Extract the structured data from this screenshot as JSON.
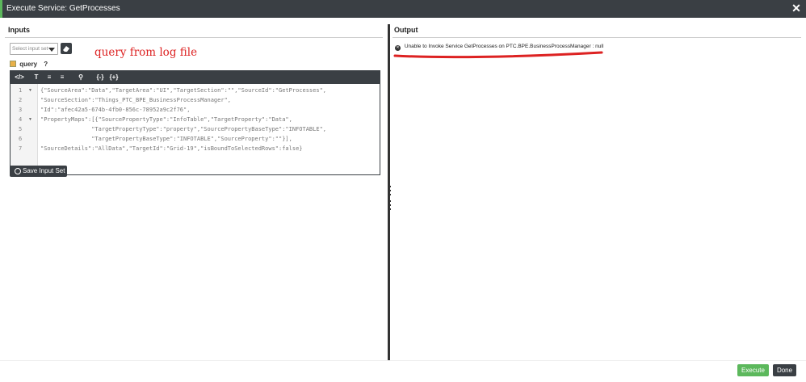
{
  "dialog": {
    "title": "Execute Service: GetProcesses",
    "close_glyph": "✕"
  },
  "inputs": {
    "header": "Inputs",
    "select_placeholder": "Select input set",
    "annotation": "query from log file",
    "param_label": "query",
    "help_glyph": "?",
    "toolbar": {
      "code_view": "</>",
      "format_text": "T",
      "align_left": "≡",
      "align_right": "≡",
      "search": "⚲",
      "collapse": "{-}",
      "expand": "{+}"
    },
    "code_lines": [
      {
        "num": "1",
        "text": "{\"SourceArea\":\"Data\",\"TargetArea\":\"UI\",\"TargetSection\":\"\",\"SourceId\":\"GetProcesses\","
      },
      {
        "num": "2",
        "text": "\"SourceSection\":\"Things_PTC_BPE_BusinessProcessManager\","
      },
      {
        "num": "3",
        "text": "\"Id\":\"afec42a5-674b-4fb0-856c-78952a9c2f76\","
      },
      {
        "num": "4",
        "text": "\"PropertyMaps\":[{\"SourcePropertyType\":\"InfoTable\",\"TargetProperty\":\"Data\","
      },
      {
        "num": "5",
        "text": "               \"TargetPropertyType\":\"property\",\"SourcePropertyBaseType\":\"INFOTABLE\","
      },
      {
        "num": "6",
        "text": "               \"TargetPropertyBaseType\":\"INFOTABLE\",\"SourceProperty\":\"\"}],"
      },
      {
        "num": "7",
        "text": "\"SourceDetails\":\"AllData\",\"TargetId\":\"Grid-19\",\"isBoundToSelectedRows\":false}"
      }
    ],
    "save_label": "Save Input Set"
  },
  "output": {
    "header": "Output",
    "error_glyph": "✕",
    "message": "Unable to Invoke Service GetProcesses on PTC.BPE.BusinessProcessManager : null"
  },
  "footer": {
    "execute_label": "Execute",
    "done_label": "Done"
  },
  "colors": {
    "titlebar": "#3a3f44",
    "accent_green": "#5cb85c",
    "annotation_red": "#dd2222"
  }
}
